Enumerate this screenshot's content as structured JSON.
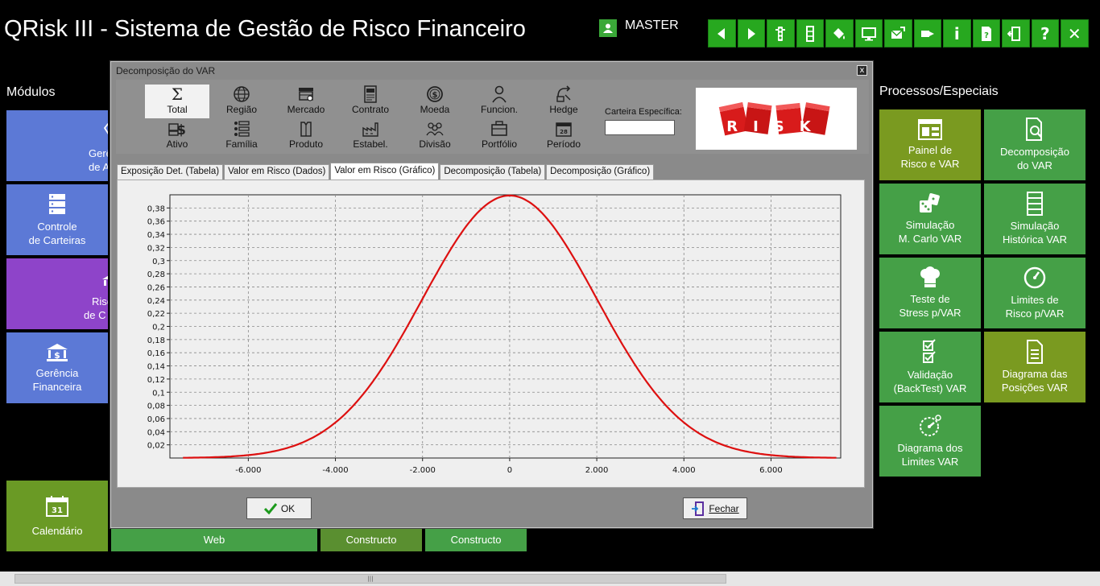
{
  "app": {
    "title": "QRisk III - Sistema de Gestão de Risco Financeiro"
  },
  "user": {
    "name": "MASTER"
  },
  "toolbar": {
    "info_label": "i",
    "help_label": "?",
    "close_label": "✕"
  },
  "sections": {
    "modules": "Módulos",
    "processes": "Processos/Especiais"
  },
  "left_tiles": [
    {
      "label_1": "Gerê",
      "label_2": "de A",
      "color": "#5c79d6"
    },
    {
      "label_1": "Controle",
      "label_2": "de Carteiras",
      "color": "#5c79d6"
    },
    {
      "label_1": "Risc",
      "label_2": "de C",
      "color": "#8e44c9"
    },
    {
      "label_1": "Gerência",
      "label_2": "Financeira",
      "color": "#5c79d6"
    },
    {
      "label_1": "Calendário",
      "color": "#6a9a25"
    }
  ],
  "bottom_tiles": [
    {
      "label": "Web",
      "color": "#45a047"
    },
    {
      "label": "Constructo",
      "color": "#5a8f30"
    },
    {
      "label": "Constructo",
      "color": "#45a047"
    }
  ],
  "right_tiles": [
    {
      "label_1": "Painel de",
      "label_2": "Risco e VAR",
      "color": "#7a9a20"
    },
    {
      "label_1": "Decomposição",
      "label_2": "do VAR",
      "color": "#45a047"
    },
    {
      "label_1": "Simulação",
      "label_2": "M. Carlo VAR",
      "color": "#45a047"
    },
    {
      "label_1": "Simulação",
      "label_2": "Histórica VAR",
      "color": "#45a047"
    },
    {
      "label_1": "Teste de",
      "label_2": "Stress p/VAR",
      "color": "#45a047"
    },
    {
      "label_1": "Limites de",
      "label_2": "Risco p/VAR",
      "color": "#45a047"
    },
    {
      "label_1": "Validação",
      "label_2": "(BackTest) VAR",
      "color": "#45a047"
    },
    {
      "label_1": "Diagrama das",
      "label_2": "Posições VAR",
      "color": "#7a9a20"
    },
    {
      "label_1": "Diagrama dos",
      "label_2": "Limites VAR",
      "color": "#45a047"
    }
  ],
  "dialog": {
    "title": "Decomposição do VAR",
    "close_label": "x",
    "dimensions": [
      "Total",
      "Região",
      "Mercado",
      "Contrato",
      "Moeda",
      "Funcion.",
      "Hedge",
      "Ativo",
      "Família",
      "Produto",
      "Estabel.",
      "Divisão",
      "Portfólio",
      "Período"
    ],
    "carteira_label": "Carteira Específica:",
    "carteira_value": "",
    "banner_text": "RISK",
    "tabs": [
      "Exposição Det. (Tabela)",
      "Valor em Risco (Dados)",
      "Valor em Risco (Gráfico)",
      "Decomposição (Tabela)",
      "Decomposição (Gráfico)"
    ],
    "active_tab": 2,
    "ok_label": "OK",
    "fechar_label": "Fechar"
  },
  "chart_data": {
    "type": "line",
    "title": "",
    "xlabel": "",
    "ylabel": "",
    "xlim": [
      -7800,
      7600
    ],
    "ylim": [
      0,
      0.4
    ],
    "x_ticks": [
      -6000,
      -4000,
      -2000,
      0,
      2000,
      4000,
      6000
    ],
    "x_tick_labels": [
      "-6.000",
      "-4.000",
      "-2.000",
      "0",
      "2.000",
      "4.000",
      "6.000"
    ],
    "y_ticks": [
      0.02,
      0.04,
      0.06,
      0.08,
      0.1,
      0.12,
      0.14,
      0.16,
      0.18,
      0.2,
      0.22,
      0.24,
      0.26,
      0.28,
      0.3,
      0.32,
      0.34,
      0.36,
      0.38
    ],
    "y_tick_labels": [
      "0,02",
      "0,04",
      "0,06",
      "0,08",
      "0,1",
      "0,12",
      "0,14",
      "0,16",
      "0,18",
      "0,2",
      "0,22",
      "0,24",
      "0,26",
      "0,28",
      "0,3",
      "0,32",
      "0,34",
      "0,36",
      "0,38"
    ],
    "grid": true,
    "series": [
      {
        "color": "#dd1010",
        "distribution": "normal",
        "mean": 0,
        "std": 2000,
        "peak": 0.3989,
        "x_range": [
          -7500,
          7500
        ]
      }
    ]
  }
}
